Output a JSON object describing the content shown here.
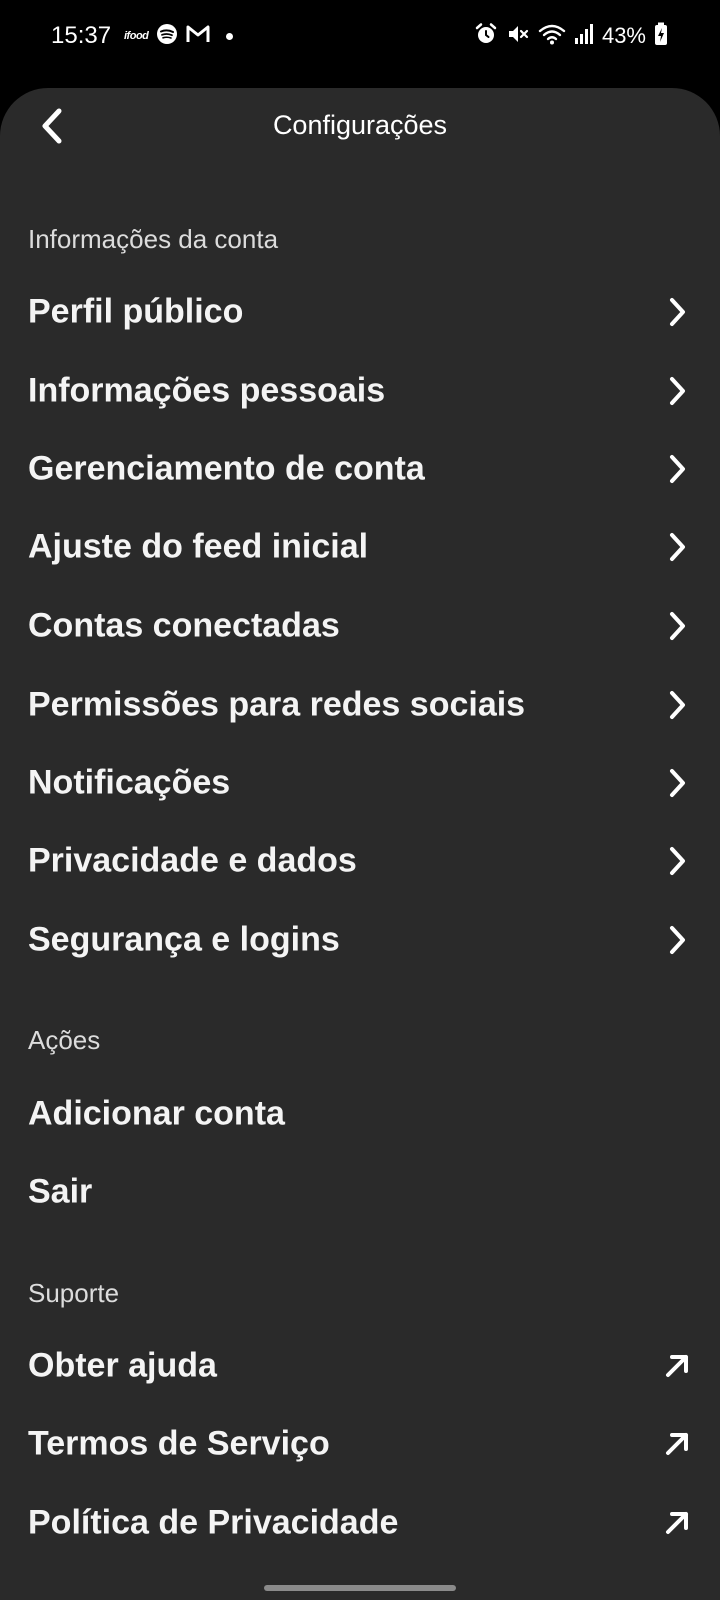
{
  "status_bar": {
    "time": "15:37",
    "ifood_label": "ifood",
    "battery_percent": "43%",
    "icons": [
      "ifood-icon",
      "spotify-icon",
      "gmail-icon",
      "notification-dot-icon",
      "alarm-icon",
      "mute-icon",
      "wifi-icon",
      "signal-icon",
      "battery-charging-icon"
    ]
  },
  "header": {
    "title": "Configurações",
    "back_icon": "back-chevron-icon"
  },
  "sections": {
    "account": {
      "label": "Informações da conta",
      "items": [
        {
          "label": "Perfil público",
          "icon": "chevron-right-icon"
        },
        {
          "label": "Informações pessoais",
          "icon": "chevron-right-icon"
        },
        {
          "label": "Gerenciamento de conta",
          "icon": "chevron-right-icon"
        },
        {
          "label": "Ajuste do feed inicial",
          "icon": "chevron-right-icon"
        },
        {
          "label": "Contas conectadas",
          "icon": "chevron-right-icon"
        },
        {
          "label": "Permissões para redes sociais",
          "icon": "chevron-right-icon"
        },
        {
          "label": "Notificações",
          "icon": "chevron-right-icon"
        },
        {
          "label": "Privacidade e dados",
          "icon": "chevron-right-icon"
        },
        {
          "label": "Segurança e logins",
          "icon": "chevron-right-icon"
        }
      ]
    },
    "actions": {
      "label": "Ações",
      "items": [
        {
          "label": "Adicionar conta"
        },
        {
          "label": "Sair"
        }
      ]
    },
    "support": {
      "label": "Suporte",
      "items": [
        {
          "label": "Obter ajuda",
          "icon": "external-link-arrow-icon"
        },
        {
          "label": "Termos de Serviço",
          "icon": "external-link-arrow-icon"
        },
        {
          "label": "Política de Privacidade",
          "icon": "external-link-arrow-icon"
        }
      ]
    }
  },
  "colors": {
    "background": "#000000",
    "sheet": "#2a2a2a",
    "text": "#ffffff",
    "section_label": "#dcdcdc"
  }
}
